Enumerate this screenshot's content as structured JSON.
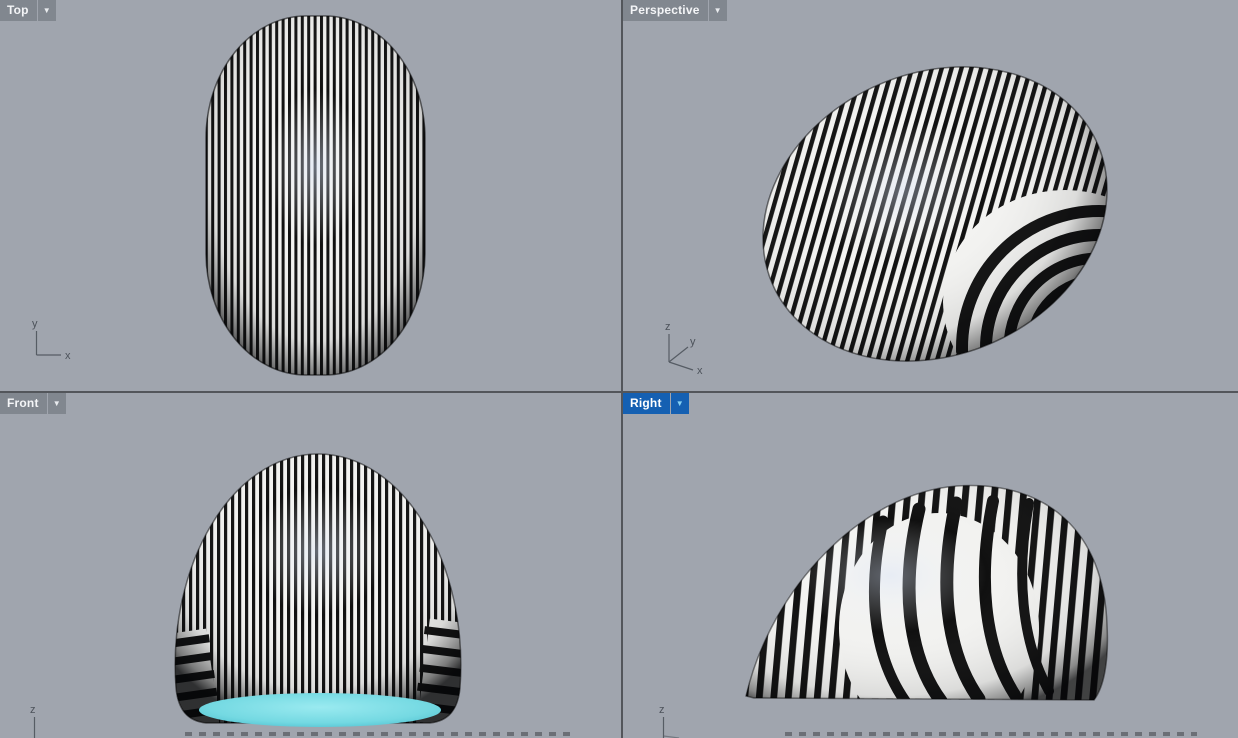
{
  "app": {
    "title": "3D modeling viewport grid (zebra surface analysis)"
  },
  "icons": {
    "chevron_down": "▼"
  },
  "colors": {
    "viewport_background": "#a0a5ae",
    "divider": "#53565b",
    "label_background": "#81878f",
    "label_text": "#f4f5f7",
    "active_label_background": "#1560b2",
    "active_menu_arrow": "#86d2f4",
    "zebra_black": "#101010",
    "zebra_white": "#f3f3f1",
    "interior_cyan": "#74d9e2",
    "axis_indicator": "#565c64"
  },
  "viewports": [
    {
      "label": "Top",
      "active": false,
      "axes": {
        "v": "y",
        "h": "x"
      }
    },
    {
      "label": "Perspective",
      "active": false,
      "axes": {
        "v": "z",
        "d": "y",
        "h": "x"
      }
    },
    {
      "label": "Front",
      "active": false,
      "axes": {
        "v": "z"
      }
    },
    {
      "label": "Right",
      "active": true,
      "axes": {
        "v": "z"
      }
    }
  ]
}
